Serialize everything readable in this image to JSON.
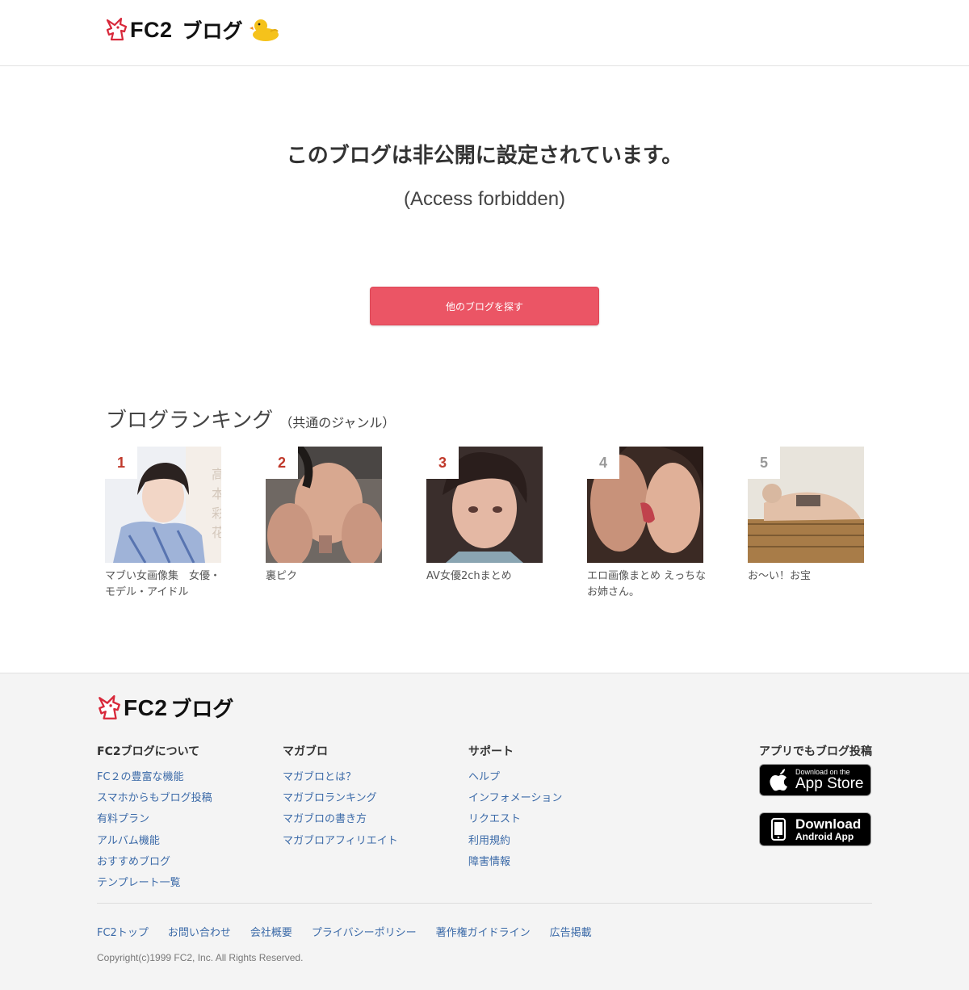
{
  "header": {
    "logo_fc2": "FC2",
    "logo_blog": "ブログ"
  },
  "message": {
    "title": "このブログは非公開に設定されています。",
    "subtitle": "(Access forbidden)",
    "button_label": "他のブログを探す"
  },
  "ranking": {
    "title": "ブログランキング",
    "genre": "（共通のジャンル）",
    "items": [
      {
        "rank": "1",
        "name": "マブい女画像集　女優・モデル・アイドル"
      },
      {
        "rank": "2",
        "name": "裏ピク"
      },
      {
        "rank": "3",
        "name": "AV女優2chまとめ"
      },
      {
        "rank": "4",
        "name": "エロ画像まとめ えっちなお姉さん。"
      },
      {
        "rank": "5",
        "name": "お〜い！お宝"
      }
    ]
  },
  "footer": {
    "logo_fc2": "FC2",
    "logo_blog": "ブログ",
    "columns": [
      {
        "title": "FC2ブログについて",
        "links": [
          "FC２の豊富な機能",
          "スマホからもブログ投稿",
          "有料プラン",
          "アルバム機能",
          "おすすめブログ",
          "テンプレート一覧"
        ]
      },
      {
        "title": "マガブロ",
        "links": [
          "マガブロとは？",
          "マガブロランキング",
          "マガブロの書き方",
          "マガブロアフィリエイト"
        ]
      },
      {
        "title": "サポート",
        "links": [
          "ヘルプ",
          "インフォメーション",
          "リクエスト",
          "利用規約",
          "障害情報"
        ]
      }
    ],
    "app_title": "アプリでもブログ投稿",
    "ios_badge": {
      "small": "Download on the",
      "big": "App Store"
    },
    "android_badge": {
      "big": "Download",
      "small": "Android App"
    },
    "bottom_links": [
      "FC2トップ",
      "お問い合わせ",
      "会社概要",
      "プライバシーポリシー",
      "著作権ガイドライン",
      "広告掲載"
    ],
    "copyright": "Copyright(c)1999 FC2, Inc. All Rights Reserved."
  },
  "colors": {
    "accent": "#eb5565",
    "link": "#3b6aa8",
    "rank_top": "#c0392b",
    "rank_other": "#999999"
  }
}
